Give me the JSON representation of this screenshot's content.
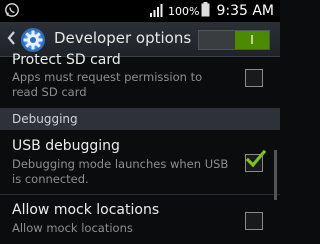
{
  "status_bar": {
    "battery": "100%",
    "time": "9:35 AM"
  },
  "action_bar": {
    "title": "Developer options",
    "toggle_label": "I"
  },
  "list": {
    "protect_sd": {
      "title": "Protect SD card",
      "subtitle_line1": "Apps must request permission to",
      "subtitle_line2": "read SD card",
      "checked": false
    },
    "section_debugging": "Debugging",
    "usb_debugging": {
      "title": "USB debugging",
      "subtitle_line1": "Debugging mode launches when USB",
      "subtitle_line2": "is connected.",
      "checked": true
    },
    "mock_locations": {
      "title": "Allow mock locations",
      "subtitle": "Allow mock locations",
      "checked": false
    }
  },
  "colors": {
    "accent_green": "#4a8b00",
    "check_green": "#7dc21e"
  }
}
